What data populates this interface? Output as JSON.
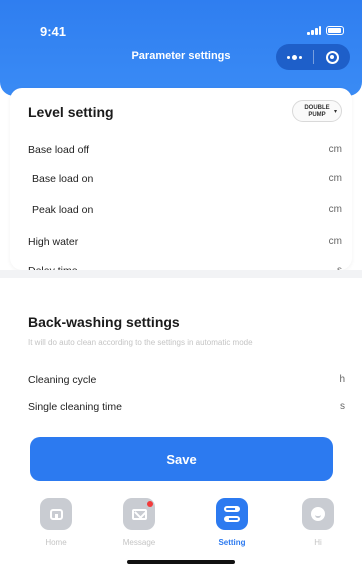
{
  "status_bar": {
    "time": "9:41",
    "signal_icon": "signal-icon",
    "battery_icon": "battery-icon"
  },
  "nav": {
    "title": "Parameter settings",
    "more_icon": "dots-icon",
    "close_icon": "target-icon"
  },
  "level_setting": {
    "title": "Level setting",
    "pump_mode_line1": "DOUBLE",
    "pump_mode_line2": "PUMP",
    "rows": [
      {
        "label": "Base load off",
        "unit": "cm"
      },
      {
        "label": "Base load on",
        "unit": "cm"
      },
      {
        "label": "Peak load on",
        "unit": "cm"
      },
      {
        "label": "High water",
        "unit": "cm"
      },
      {
        "label": "Delay time",
        "unit": "s"
      }
    ]
  },
  "back_washing": {
    "title": "Back-washing settings",
    "hint": "It will do auto clean according to the settings in automatic mode",
    "rows": [
      {
        "label": "Cleaning cycle",
        "unit": "h"
      },
      {
        "label": "Single cleaning time",
        "unit": "s"
      }
    ]
  },
  "save_label": "Save",
  "tabbar": {
    "tabs": [
      {
        "label": "Home",
        "icon": "home-icon",
        "active": false
      },
      {
        "label": "Message",
        "icon": "message-icon",
        "active": false,
        "badge": true
      },
      {
        "label": "Setting",
        "icon": "setting-icon",
        "active": true
      },
      {
        "label": "Hi",
        "icon": "face-icon",
        "active": false
      }
    ]
  },
  "colors": {
    "accent": "#2c7af0",
    "header": "#3a8bf5",
    "inactive_icon": "#c9ccd2",
    "badge": "#f23b3b"
  }
}
